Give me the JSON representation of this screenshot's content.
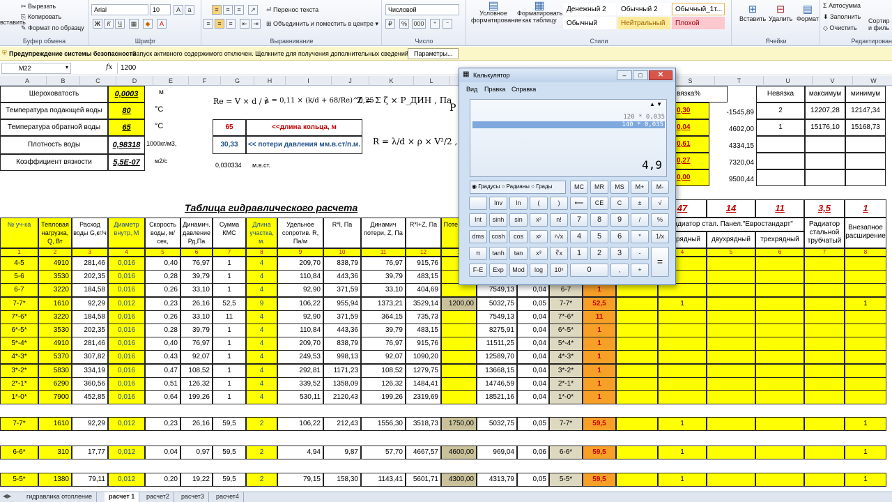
{
  "ribbon": {
    "clipboard": {
      "cut": "Вырезать",
      "copy": "Копировать",
      "format_painter": "Формат по образцу",
      "label": "Буфер обмена",
      "paste": "вставить"
    },
    "font": {
      "name": "Arial",
      "size": "10",
      "label": "Шрифт"
    },
    "alignment": {
      "wrap": "Перенос текста",
      "merge": "Объединить и поместить в центре",
      "label": "Выравнивание"
    },
    "number": {
      "format": "Числовой",
      "label": "Число",
      "pct": "%",
      "thousands": "000"
    },
    "styles": {
      "conditional": "Условное форматирование",
      "as_table": "Форматировать как таблицу",
      "label": "Стили",
      "cells": [
        {
          "label": "Денежный 2",
          "bg": "#ffffff"
        },
        {
          "label": "Обычный 2",
          "bg": "#ffffff"
        },
        {
          "label": "Обычный_1т...",
          "bg": "#ffffff"
        },
        {
          "label": "Обычный",
          "bg": "#ffffff"
        },
        {
          "label": "Нейтральный",
          "bg": "#ffeb9c"
        },
        {
          "label": "Плохой",
          "bg": "#ffc7ce"
        }
      ]
    },
    "cells": {
      "insert": "Вставить",
      "delete": "Удалить",
      "format": "Формат",
      "label": "Ячейки"
    },
    "editing": {
      "autosum": "Автосумма",
      "fill": "Заполнить",
      "clear": "Очистить",
      "sort": "Сортир и филь",
      "label": "Редактирован"
    }
  },
  "security": {
    "title": "Предупреждение системы безопасности",
    "message": "Запуск активного содержимого отключен. Щелкните для получения дополнительных сведений.",
    "button": "Параметры..."
  },
  "formula": {
    "namebox": "M22",
    "fx": "fx",
    "value": "1200"
  },
  "columns": [
    "A",
    "B",
    "C",
    "D",
    "E",
    "F",
    "G",
    "H",
    "I",
    "J",
    "K",
    "L",
    "M",
    "N",
    "O",
    "P",
    "Q",
    "R",
    "S",
    "T",
    "U",
    "V",
    "W"
  ],
  "params": [
    {
      "label": "Шероховатость",
      "value": "0,0003",
      "unit": "м"
    },
    {
      "label": "Температура подающей воды",
      "value": "80",
      "unit": "°C"
    },
    {
      "label": "Температура обратной воды",
      "value": "65",
      "unit": "°C"
    },
    {
      "label": "Плотность воды",
      "value": "0,98318",
      "unit": "1000кг/м3,"
    },
    {
      "label": "Коэффициент вязкости",
      "value": "5,5E-07",
      "unit": "м2/с"
    }
  ],
  "ring": {
    "value": "65",
    "label": "<<длина кольца, м"
  },
  "loss": {
    "value": "30,33",
    "label": "<< потери давления мм.в.ст/п.м."
  },
  "water_col": {
    "value": "0,030334",
    "unit": "м.в.ст."
  },
  "formulas": {
    "re": "Re = V × d / ν",
    "lambda": "λ = 0,11 × (k/d + 68/Re)^0,25",
    "z": "Z = Σ ζ × P_ДИН , Па",
    "r": "R = λ/d × ρ × V²/2 , Па",
    "p": "P"
  },
  "right_panel": {
    "header": [
      "вязка%",
      "",
      "Невязка",
      "максимум",
      "минимум"
    ],
    "rows": [
      [
        "0,30",
        "-1545,89",
        "2",
        "12207,28",
        "12147,34"
      ],
      [
        "0,04",
        "4602,00",
        "1",
        "15176,10",
        "15168,73"
      ],
      [
        "0,61",
        "4334,15",
        "",
        "",
        ""
      ],
      [
        "0,27",
        "7320,04",
        "",
        "",
        ""
      ],
      [
        "0,00",
        "9500,44",
        "",
        "",
        ""
      ]
    ]
  },
  "table_title": "Таблица гидравлического расчета",
  "headers": [
    "№ уч-ка",
    "Тепловая нагрузка, Q, Вт",
    "Расход воды G,кг/ч",
    "Диаметр внутр, М",
    "Скорость воды, м/сек,",
    "Динамич. давление Рд,Па",
    "Сумма КМС",
    "Длина участка, м.",
    "Удельное сопротив. R, Па/м",
    "R*l, Па",
    "Динамич потери, Z, Па",
    "R*l+Z, Па",
    "Поте элем"
  ],
  "header_nums": [
    "1",
    "2",
    "3",
    "4",
    "5",
    "6",
    "7",
    "8",
    "9",
    "10",
    "11",
    "12",
    "1"
  ],
  "right_headers": {
    "counts": [
      "47",
      "14",
      "11",
      "3,5",
      "1"
    ],
    "labels": [
      "Радиатор стал. Панел.\"Евростандарт\"",
      "Радиатор стальной трубчатый",
      "Внезапное расширение"
    ],
    "sub": [
      "днорядный",
      "двухрядный",
      "трехрядный"
    ],
    "nums": [
      "4",
      "5",
      "6",
      "7",
      "8"
    ]
  },
  "rows": [
    {
      "n": "4-5",
      "q": "4910",
      "g": "281,46",
      "d": "0,016",
      "v": "0,40",
      "p": "76,97",
      "k": "1",
      "l": "4",
      "r": "209,70",
      "rl": "838,79",
      "z": "76,97",
      "s": "915,76",
      "m": "",
      "o": "",
      "pp": "",
      "qn": "",
      "qv": "",
      "u": "",
      "w": ""
    },
    {
      "n": "5-6",
      "q": "3530",
      "g": "202,35",
      "d": "0,016",
      "v": "0,28",
      "p": "39,79",
      "k": "1",
      "l": "4",
      "r": "110,84",
      "rl": "443,36",
      "z": "39,79",
      "s": "483,15",
      "m": "",
      "o": "",
      "pp": "",
      "qn": "",
      "qv": "",
      "u": "",
      "w": ""
    },
    {
      "n": "6-7",
      "q": "3220",
      "g": "184,58",
      "d": "0,016",
      "v": "0,26",
      "p": "33,10",
      "k": "1",
      "l": "4",
      "r": "92,90",
      "rl": "371,59",
      "z": "33,10",
      "s": "404,69",
      "m": "",
      "o": "7549,13",
      "pp": "0,04",
      "qn": "6-7",
      "qv": "1",
      "u": "",
      "w": ""
    },
    {
      "n": "7-7*",
      "q": "1610",
      "g": "92,29",
      "d": "0,012",
      "v": "0,23",
      "p": "26,16",
      "k": "52,5",
      "l": "9",
      "r": "106,22",
      "rl": "955,94",
      "z": "1373,21",
      "s": "3529,14",
      "m": "1200,00",
      "o": "5032,75",
      "pp": "0,05",
      "qn": "7-7*",
      "qv": "52,5",
      "u": "1",
      "w": "1"
    },
    {
      "n": "7*-6*",
      "q": "3220",
      "g": "184,58",
      "d": "0,016",
      "v": "0,26",
      "p": "33,10",
      "k": "11",
      "l": "4",
      "r": "92,90",
      "rl": "371,59",
      "z": "364,15",
      "s": "735,73",
      "m": "",
      "o": "7549,13",
      "pp": "0,04",
      "qn": "7*-6*",
      "qv": "11",
      "u": "",
      "w": ""
    },
    {
      "n": "6*-5*",
      "q": "3530",
      "g": "202,35",
      "d": "0,016",
      "v": "0,28",
      "p": "39,79",
      "k": "1",
      "l": "4",
      "r": "110,84",
      "rl": "443,36",
      "z": "39,79",
      "s": "483,15",
      "m": "",
      "o": "8275,91",
      "pp": "0,04",
      "qn": "6*-5*",
      "qv": "1",
      "u": "",
      "w": ""
    },
    {
      "n": "5*-4*",
      "q": "4910",
      "g": "281,46",
      "d": "0,016",
      "v": "0,40",
      "p": "76,97",
      "k": "1",
      "l": "4",
      "r": "209,70",
      "rl": "838,79",
      "z": "76,97",
      "s": "915,76",
      "m": "",
      "o": "11511,25",
      "pp": "0,04",
      "qn": "5*-4*",
      "qv": "1",
      "u": "",
      "w": ""
    },
    {
      "n": "4*-3*",
      "q": "5370",
      "g": "307,82",
      "d": "0,016",
      "v": "0,43",
      "p": "92,07",
      "k": "1",
      "l": "4",
      "r": "249,53",
      "rl": "998,13",
      "z": "92,07",
      "s": "1090,20",
      "m": "",
      "o": "12589,70",
      "pp": "0,04",
      "qn": "4*-3*",
      "qv": "1",
      "u": "",
      "w": ""
    },
    {
      "n": "3*-2*",
      "q": "5830",
      "g": "334,19",
      "d": "0,016",
      "v": "0,47",
      "p": "108,52",
      "k": "1",
      "l": "4",
      "r": "292,81",
      "rl": "1171,23",
      "z": "108,52",
      "s": "1279,75",
      "m": "",
      "o": "13668,15",
      "pp": "0,04",
      "qn": "3*-2*",
      "qv": "1",
      "u": "",
      "w": ""
    },
    {
      "n": "2*-1*",
      "q": "6290",
      "g": "360,56",
      "d": "0,016",
      "v": "0,51",
      "p": "126,32",
      "k": "1",
      "l": "4",
      "r": "339,52",
      "rl": "1358,09",
      "z": "126,32",
      "s": "1484,41",
      "m": "",
      "o": "14746,59",
      "pp": "0,04",
      "qn": "2*-1*",
      "qv": "1",
      "u": "",
      "w": ""
    },
    {
      "n": "1*-0*",
      "q": "7900",
      "g": "452,85",
      "d": "0,016",
      "v": "0,64",
      "p": "199,26",
      "k": "1",
      "l": "4",
      "r": "530,11",
      "rl": "2120,43",
      "z": "199,26",
      "s": "2319,69",
      "m": "",
      "o": "18521,16",
      "pp": "0,04",
      "qn": "1*-0*",
      "qv": "1",
      "u": "",
      "w": ""
    }
  ],
  "rows2": [
    {
      "n": "7-7*",
      "q": "1610",
      "g": "92,29",
      "d": "0,012",
      "v": "0,23",
      "p": "26,16",
      "k": "59,5",
      "l": "2",
      "r": "106,22",
      "rl": "212,43",
      "z": "1556,30",
      "s": "3518,73",
      "m": "1750,00",
      "o": "5032,75",
      "pp": "0,05",
      "qn": "7-7*",
      "qv": "59,5",
      "u": "1",
      "w": "1"
    },
    {
      "n": "6-6*",
      "q": "310",
      "g": "17,77",
      "d": "0,012",
      "v": "0,04",
      "p": "0,97",
      "k": "59,5",
      "l": "2",
      "r": "4,94",
      "rl": "9,87",
      "z": "57,70",
      "s": "4667,57",
      "m": "4600,00",
      "o": "969,04",
      "pp": "0,06",
      "qn": "6-6*",
      "qv": "59,5",
      "u": "1",
      "w": "1"
    },
    {
      "n": "5-5*",
      "q": "1380",
      "g": "79,11",
      "d": "0,012",
      "v": "0,20",
      "p": "19,22",
      "k": "59,5",
      "l": "2",
      "r": "79,15",
      "rl": "158,30",
      "z": "1143,41",
      "s": "5601,71",
      "m": "4300,00",
      "o": "4313,79",
      "pp": "0,05",
      "qn": "5-5*",
      "qv": "59,5",
      "u": "1",
      "w": "1"
    }
  ],
  "sheets": [
    "гидравлика отопление",
    "расчет 1",
    "расчет2",
    "расчет3",
    "расчет4"
  ],
  "calc": {
    "title": "Калькулятор",
    "menu": [
      "Вид",
      "Правка",
      "Справка"
    ],
    "history": [
      "120 * 0,035",
      "140 * 0,035"
    ],
    "display": "4,9",
    "modes": [
      "Градусы",
      "Радианы",
      "Грады"
    ],
    "mem": [
      "MC",
      "MR",
      "MS",
      "M+",
      "M-"
    ],
    "keys": [
      [
        "",
        "Inv",
        "ln",
        "(",
        ")",
        "⟵",
        "CE",
        "C",
        "±",
        "√"
      ],
      [
        "Int",
        "sinh",
        "sin",
        "x²",
        "n!",
        "7",
        "8",
        "9",
        "/",
        "%"
      ],
      [
        "dms",
        "cosh",
        "cos",
        "xʸ",
        "ʸ√x",
        "4",
        "5",
        "6",
        "*",
        "1/x"
      ],
      [
        "π",
        "tanh",
        "tan",
        "x³",
        "∛x",
        "1",
        "2",
        "3",
        "-",
        "="
      ],
      [
        "F-E",
        "Exp",
        "Mod",
        "log",
        "10ˣ",
        "0",
        "",
        ",",
        "+",
        ""
      ]
    ]
  }
}
